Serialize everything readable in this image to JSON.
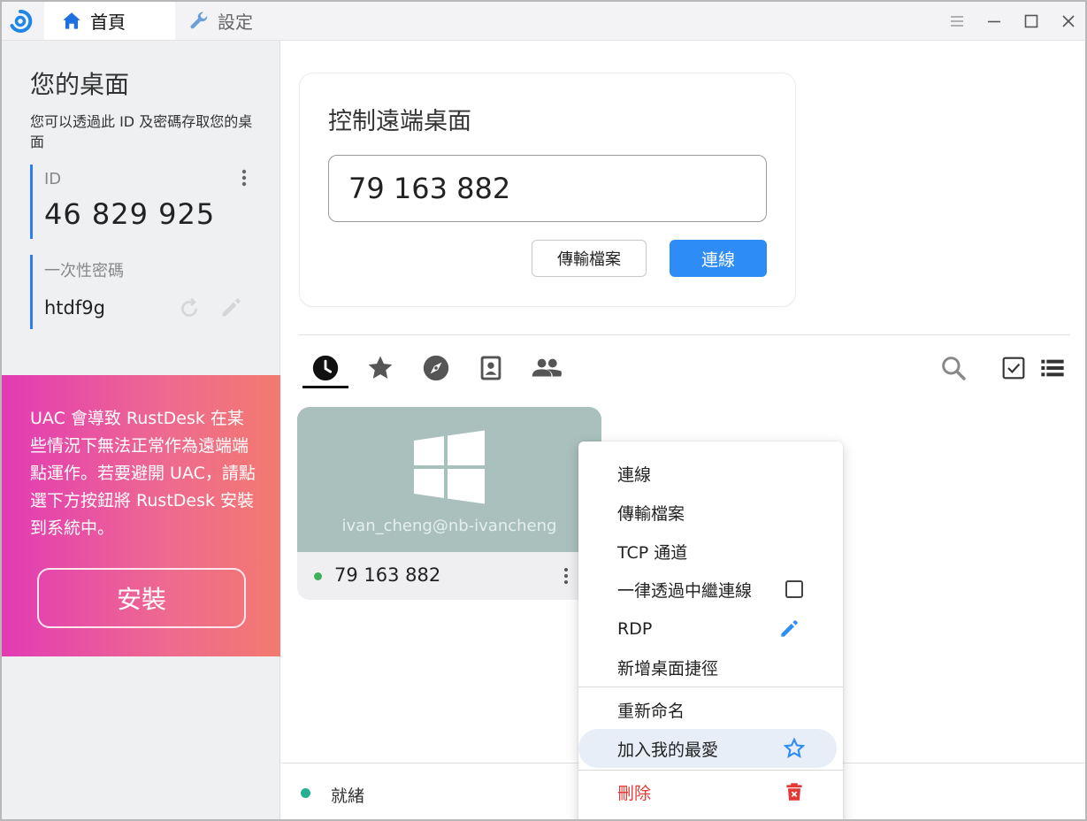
{
  "titlebar": {
    "tabs": [
      {
        "label": "首頁",
        "icon": "home-icon"
      },
      {
        "label": "設定",
        "icon": "wrench-icon"
      }
    ]
  },
  "left": {
    "title": "您的桌面",
    "description": "您可以透過此 ID 及密碼存取您的桌面",
    "id_label": "ID",
    "id_value": "46 829 925",
    "password_label": "一次性密碼",
    "password_value": "htdf9g",
    "uac_message": "UAC 會導致 RustDesk 在某些情況下無法正常作為遠端端點運作。若要避開 UAC，請點選下方按鈕將 RustDesk 安裝到系統中。",
    "install_label": "安裝"
  },
  "connect": {
    "title": "控制遠端桌面",
    "remote_id": "79 163 882",
    "transfer_label": "傳輸檔案",
    "connect_label": "連線"
  },
  "peer": {
    "username": "ivan_cheng@nb-ivancheng",
    "id": "79 163 882",
    "os_icon": "windows-icon"
  },
  "context_menu": {
    "items": [
      "連線",
      "傳輸檔案",
      "TCP 通道",
      "一律透過中繼連線",
      "RDP",
      "新增桌面捷徑",
      "重新命名",
      "加入我的最愛",
      "刪除"
    ]
  },
  "status": {
    "text": "就緒"
  },
  "colors": {
    "accent": "#2d8cf5",
    "delete": "#e53935",
    "online": "#3fb15b"
  }
}
